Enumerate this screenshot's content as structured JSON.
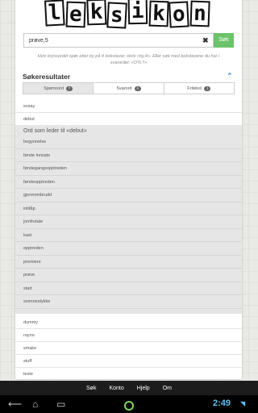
{
  "logo": {
    "letters": [
      "l",
      "e",
      "k",
      "s",
      "i",
      "k",
      "o",
      "n"
    ]
  },
  "search": {
    "value": "prøve,5",
    "button_label": "Søk",
    "clear_glyph": "✖"
  },
  "hint": "Hvis kryssordet spør etter by på 4 bokstaver, skriv «by,4». Eller søk med bokstavene du har i svarordet: «O?L?»",
  "results": {
    "title": "Søkeresultater",
    "tabs": [
      {
        "label": "Spørreord",
        "count": "7",
        "active": true
      },
      {
        "label": "Svarord",
        "count": "4",
        "active": false
      },
      {
        "label": "Fritekst",
        "count": "1",
        "active": false
      }
    ],
    "top_items": [
      "essay",
      "debut"
    ],
    "related_title": "Ord som leder til «debut»",
    "related_items": [
      "begynnelse",
      "første innsats",
      "førstegangsopptreden",
      "førsteopptreden",
      "gjennombrudd",
      "inldåp",
      "jomfrutale",
      "kast",
      "opptreden",
      "premiere",
      "prøve",
      "start",
      "svennestykke"
    ],
    "bottom_items": [
      "dummy",
      "rayno",
      "smake",
      "stuff",
      "teste"
    ]
  },
  "nav": {
    "items": [
      "Søk",
      "Konto",
      "Hjelp",
      "Om"
    ]
  },
  "system": {
    "clock": "2:49"
  }
}
